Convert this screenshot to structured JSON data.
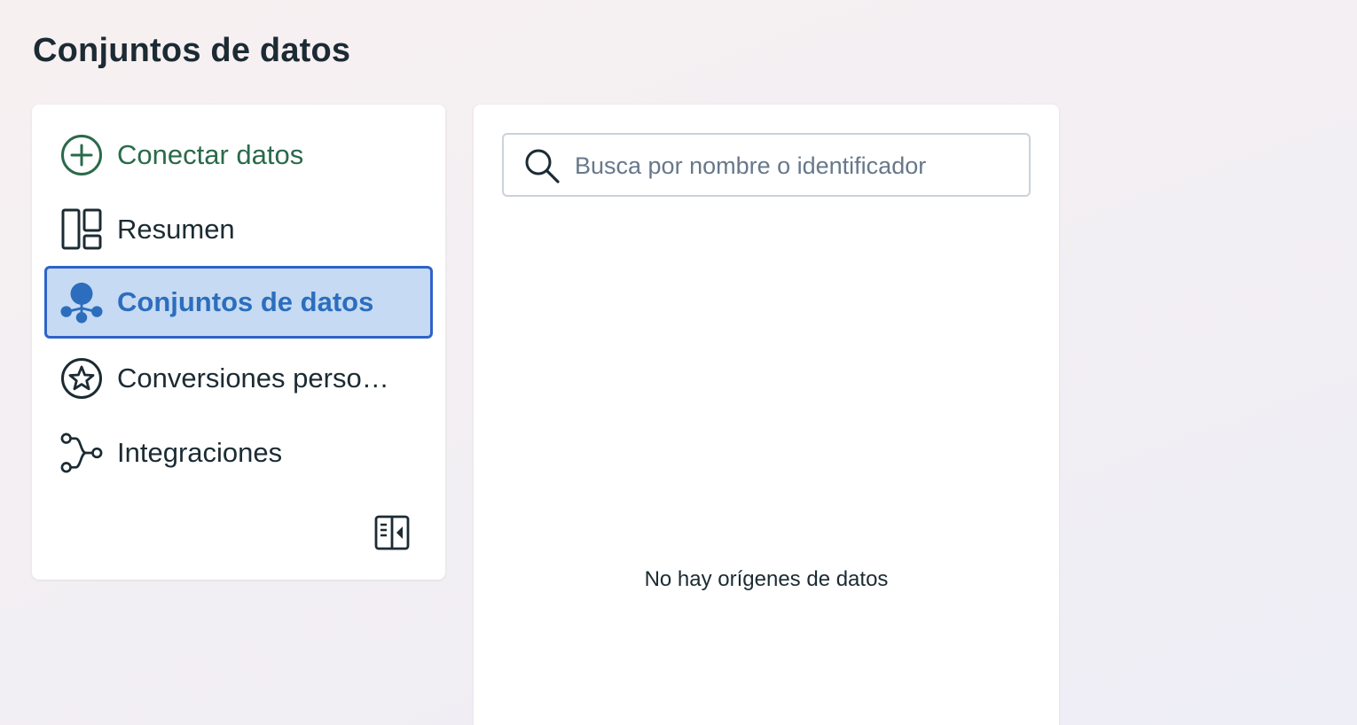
{
  "page": {
    "title": "Conjuntos de datos"
  },
  "sidebar": {
    "items": [
      {
        "id": "connect",
        "label": "Conectar datos",
        "icon": "plus-circle-icon",
        "color": "#2a6a4b"
      },
      {
        "id": "summary",
        "label": "Resumen",
        "icon": "layout-icon"
      },
      {
        "id": "datasets",
        "label": "Conjuntos de datos",
        "icon": "dataset-network-icon",
        "active": true,
        "color": "#2c6ebd"
      },
      {
        "id": "conversions",
        "label": "Conversiones personalizadas",
        "display_label": "Conversiones perso…",
        "icon": "star-circle-icon"
      },
      {
        "id": "integrations",
        "label": "Integraciones",
        "icon": "integration-flow-icon"
      }
    ],
    "collapse_icon": "collapse-sidebar-icon"
  },
  "main": {
    "search": {
      "placeholder": "Busca por nombre o identificador",
      "value": ""
    },
    "empty_message": "No hay orígenes de datos"
  },
  "colors": {
    "accent_active_bg": "#c6daf3",
    "accent_active_border": "#2e63c9",
    "text_primary": "#1c2b33"
  }
}
